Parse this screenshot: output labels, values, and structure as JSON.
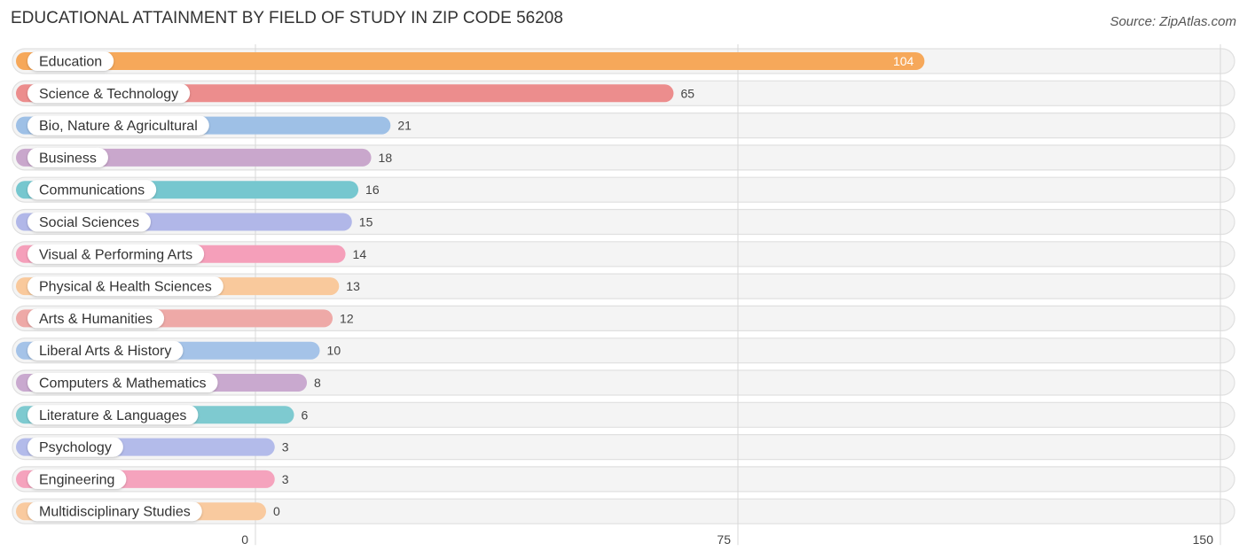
{
  "header": {
    "title": "EDUCATIONAL ATTAINMENT BY FIELD OF STUDY IN ZIP CODE 56208",
    "source": "Source: ZipAtlas.com"
  },
  "chart_data": {
    "type": "bar",
    "orientation": "horizontal",
    "title": "EDUCATIONAL ATTAINMENT BY FIELD OF STUDY IN ZIP CODE 56208",
    "xlabel": "",
    "ylabel": "",
    "xlim": [
      0,
      150
    ],
    "ticks": [
      0,
      75,
      150
    ],
    "tick_labels": [
      "0",
      "75",
      "150"
    ],
    "grid": true,
    "categories": [
      "Education",
      "Science & Technology",
      "Bio, Nature & Agricultural",
      "Business",
      "Communications",
      "Social Sciences",
      "Visual & Performing Arts",
      "Physical & Health Sciences",
      "Arts & Humanities",
      "Liberal Arts & History",
      "Computers & Mathematics",
      "Literature & Languages",
      "Psychology",
      "Engineering",
      "Multidisciplinary Studies"
    ],
    "values": [
      104,
      65,
      21,
      18,
      16,
      15,
      14,
      13,
      12,
      10,
      8,
      6,
      3,
      3,
      0
    ],
    "colors": [
      "#f6a85a",
      "#ec8d8d",
      "#9ec0e6",
      "#c9a7cc",
      "#76c7cf",
      "#b1b7e8",
      "#f59fba",
      "#f9c99c",
      "#eea9a7",
      "#a5c3e8",
      "#c9a9cf",
      "#7ecad0",
      "#b3bbea",
      "#f5a3bd",
      "#f9ca9f"
    ]
  }
}
